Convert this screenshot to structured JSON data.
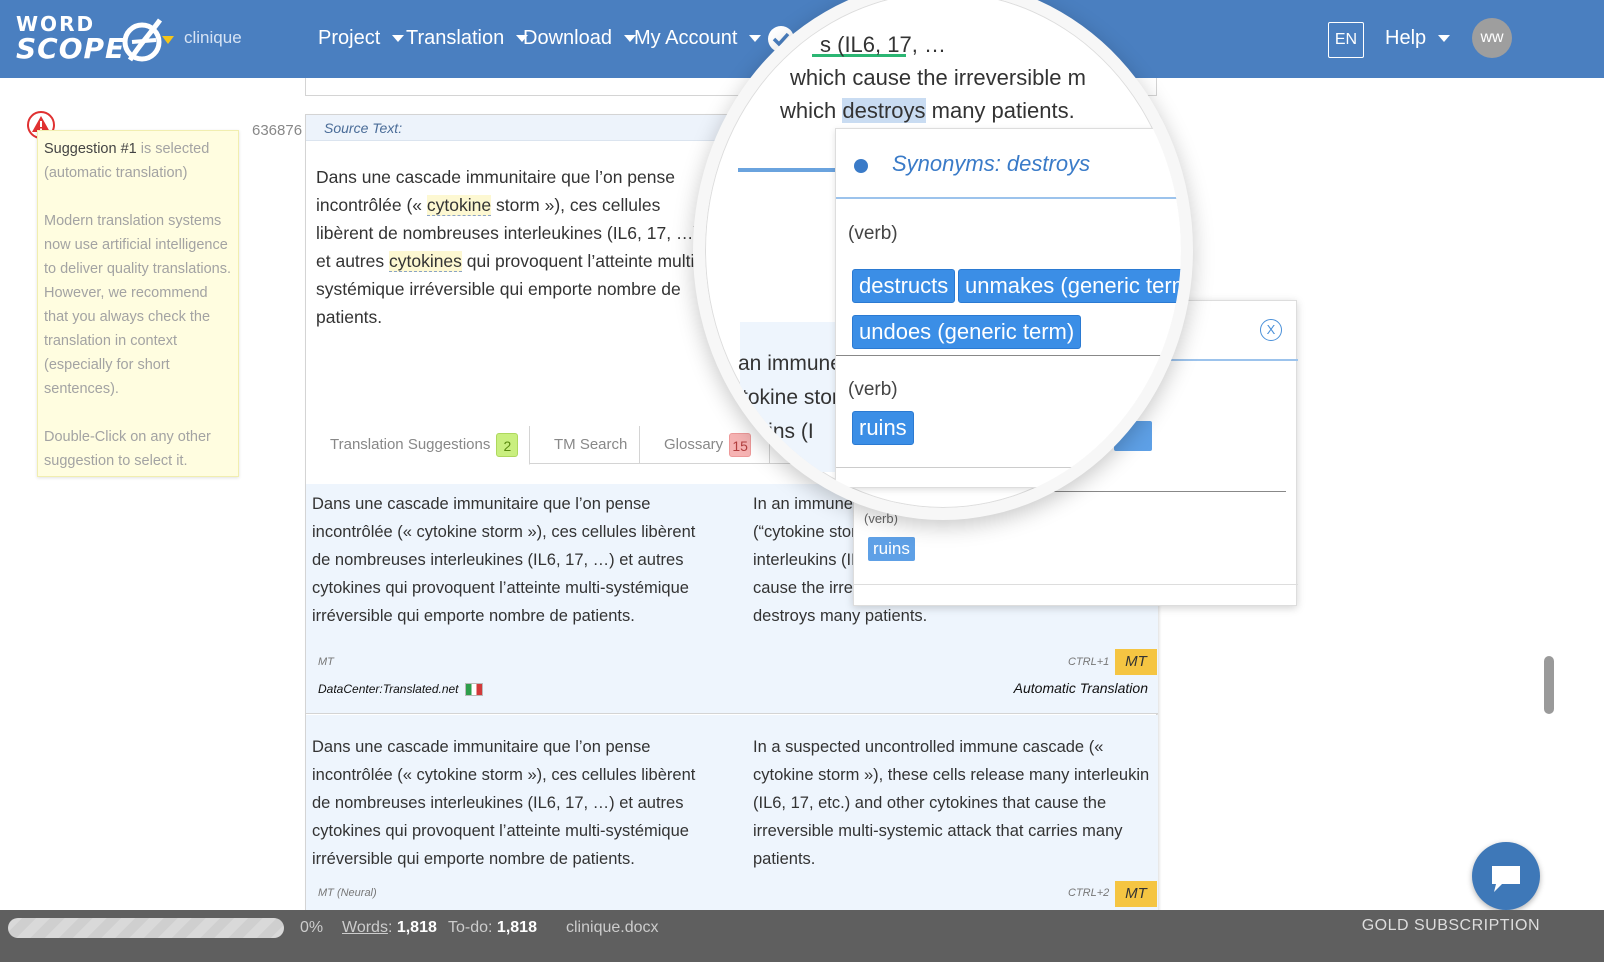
{
  "app": {
    "logo_top": "WORD",
    "logo_bottom": "SCOPE",
    "project_name": "clinique"
  },
  "nav": {
    "project": "Project",
    "translation": "Translation",
    "download": "Download",
    "my_account": "My Account",
    "lang": "EN",
    "help": "Help",
    "avatar": "ww"
  },
  "note": {
    "title_prefix": "Suggestion #1",
    "title_suffix": " is selected",
    "subtitle": "(automatic translation)",
    "body": "Modern translation systems now use artificial intelligence to deliver quality translations. However, we recommend that you always check the translation in context (especially for short sentences).",
    "tip": "Double-Click on any other suggestion to select it."
  },
  "segment": {
    "id": "636876",
    "source_label": "Source Text:",
    "source_parts": {
      "p1": "Dans une cascade immunitaire que l’on pense incontrôlée (« ",
      "hl1": "cytokine",
      "p2": " storm »), ces cellules libèrent de nombreuses interleukines (IL6, 17, …) et autres ",
      "hl2": "cytokines",
      "p3": " qui provoquent l’atteinte multi-systémique irréversible qui emporte nombre de patients."
    }
  },
  "tabs": {
    "suggestions": "Translation Suggestions",
    "suggestions_count": "2",
    "tm_search": "TM Search",
    "glossary": "Glossary",
    "glossary_count": "15"
  },
  "suggestions": [
    {
      "source": "Dans une cascade immunitaire que l’on pense incontrôlée (« cytokine storm »), ces cellules libèrent de nombreuses interleukines (IL6, 17, …) et autres cytokines qui provoquent l’atteinte multi-systémique irréversible qui emporte nombre de patients.",
      "target": "In an immune cascade thought to be uncontrolled (“cytokine storm”), these cells release many interleukins (IL6, 17, …) and other cytokines which cause the irreversible multi-systemic attack which destroys many patients.",
      "type": "MT",
      "shortcut": "CTRL+1",
      "badge": "MT",
      "provider": "DataCenter:Translated.net",
      "label": "Automatic Translation"
    },
    {
      "source": "Dans une cascade immunitaire que l’on pense incontrôlée (« cytokine storm »), ces cellules libèrent de nombreuses interleukines (IL6, 17, …) et autres cytokines qui provoquent l’atteinte multi-systémique irréversible qui emporte nombre de patients.",
      "target": "In a suspected uncontrolled immune cascade (« cytokine storm »), these cells release many interleukin (IL6, 17, etc.) and other cytokines that cause the irreversible multi-systemic attack that carries many patients.",
      "type": "MT (Neural)",
      "shortcut": "CTRL+2",
      "badge": "MT"
    }
  ],
  "magnifier": {
    "line1_a": "s (IL6, 17, …",
    "line2_a": "which cause the irreversible m",
    "line3_pre": "which ",
    "line3_hl": "destroys",
    "line3_post": " many patients.",
    "synonyms_title": "Synonyms: destroys",
    "verb_label": "(verb)",
    "chips_group1": [
      "destructs",
      "unmakes (generic term)",
      "undoes (generic term)"
    ],
    "chips_group2": [
      "ruins"
    ],
    "bg1": "an immune",
    "bg2": "tokine stor",
    "bg3": "ukins (I"
  },
  "popup": {
    "close": "X",
    "verb_label": "(verb)",
    "chip": "ruins"
  },
  "status": {
    "percent": "0%",
    "words_label": "Words",
    "words_value": "1,818",
    "todo_label": "To-do:",
    "todo_value": "1,818",
    "file": "clinique.docx",
    "subscription": "GOLD SUBSCRIPTION",
    "progress": 0
  }
}
